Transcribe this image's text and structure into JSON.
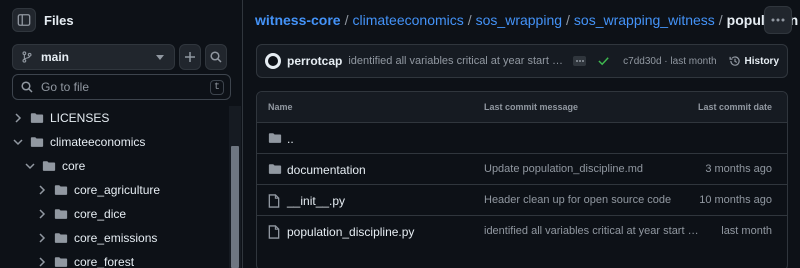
{
  "colors": {
    "background": "#0d1117",
    "panel": "#161b22",
    "border": "#30363d",
    "link": "#4493f8",
    "text": "#e6edf3",
    "muted": "#9198a1",
    "success": "#3fb950"
  },
  "sidebar": {
    "title": "Files",
    "branch": "main",
    "search_placeholder": "Go to file",
    "search_shortcut": "t",
    "tree": [
      {
        "name": "LICENSES",
        "indent": 0,
        "expanded": false
      },
      {
        "name": "climateeconomics",
        "indent": 0,
        "expanded": true
      },
      {
        "name": "core",
        "indent": 1,
        "expanded": true
      },
      {
        "name": "core_agriculture",
        "indent": 2,
        "expanded": false
      },
      {
        "name": "core_dice",
        "indent": 2,
        "expanded": false
      },
      {
        "name": "core_emissions",
        "indent": 2,
        "expanded": false
      },
      {
        "name": "core_forest",
        "indent": 2,
        "expanded": false
      }
    ]
  },
  "breadcrumb": {
    "items": [
      "witness-core",
      "climateeconomics",
      "sos_wrapping",
      "sos_wrapping_witness"
    ],
    "separator": "/",
    "current": "population",
    "trailing": "/"
  },
  "commit": {
    "author": "perrotcap",
    "message": "identified all variables critical at year start and start year",
    "sha_time": "c7dd30d · last month",
    "history_label": "History"
  },
  "files": {
    "headers": {
      "name": "Name",
      "message": "Last commit message",
      "date": "Last commit date"
    },
    "rows": [
      {
        "name": "..",
        "type": "folder",
        "message": "",
        "date": ""
      },
      {
        "name": "documentation",
        "type": "folder",
        "message": "Update population_discipline.md",
        "date": "3 months ago"
      },
      {
        "name": "__init__.py",
        "type": "file",
        "message": "Header clean up for open source code",
        "date": "10 months ago"
      },
      {
        "name": "population_discipline.py",
        "type": "file",
        "message": "identified all variables critical at year start and start year",
        "date": "last month"
      }
    ]
  }
}
